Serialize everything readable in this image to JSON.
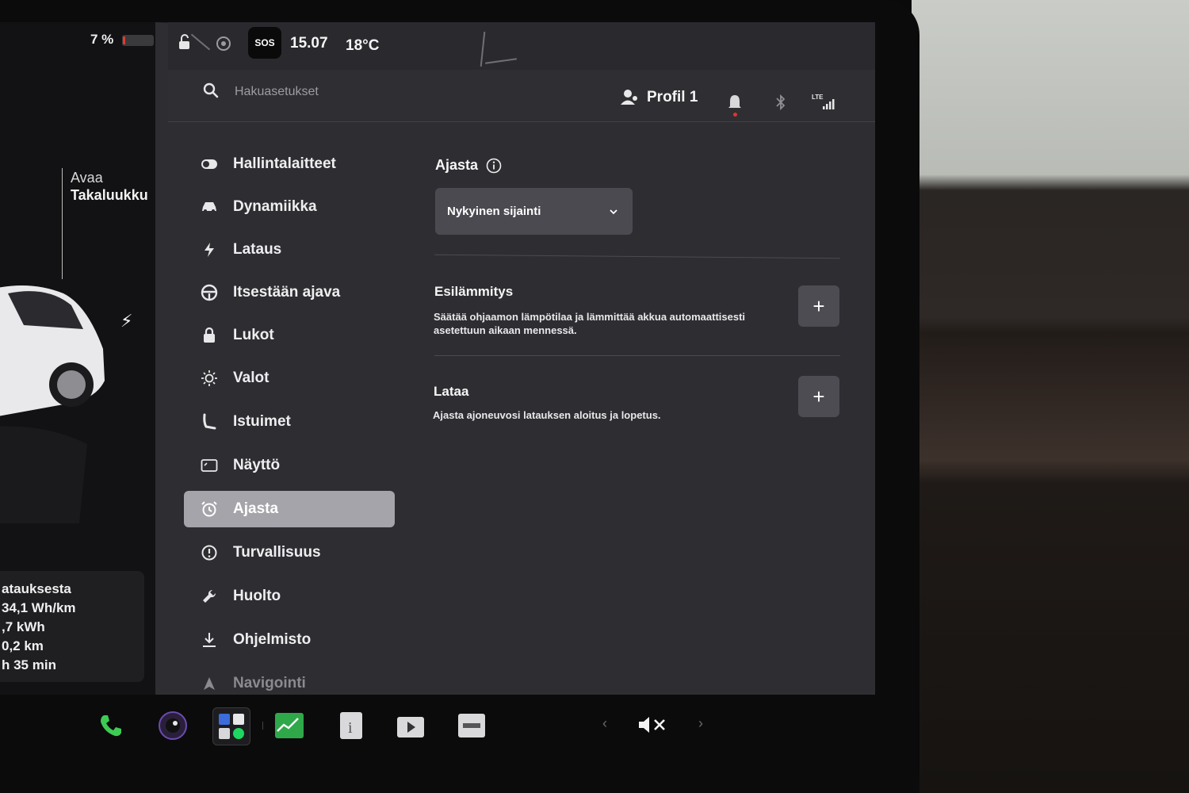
{
  "status": {
    "battery_percent": "7 %",
    "battery_level": 0.07,
    "time": "15.07",
    "temperature": "18°C",
    "sos_label": "SOS"
  },
  "car": {
    "trunk_action": "Avaa",
    "trunk_target": "Takaluukku"
  },
  "trip": {
    "rows": [
      "atauksesta",
      "34,1 Wh/km",
      ",7 kWh",
      "0,2 km",
      "h 35 min"
    ]
  },
  "search": {
    "placeholder": "Hakuasetukset"
  },
  "header": {
    "profile_label": "Profil 1",
    "lte_label": "LTE"
  },
  "sidebar": {
    "items": [
      {
        "label": "Hallintalaitteet",
        "icon": "toggle-icon"
      },
      {
        "label": "Dynamiikka",
        "icon": "car-icon"
      },
      {
        "label": "Lataus",
        "icon": "bolt-icon"
      },
      {
        "label": "Itsestään ajava",
        "icon": "steering-wheel-icon"
      },
      {
        "label": "Lukot",
        "icon": "lock-icon"
      },
      {
        "label": "Valot",
        "icon": "sun-icon"
      },
      {
        "label": "Istuimet",
        "icon": "seat-icon"
      },
      {
        "label": "Näyttö",
        "icon": "display-icon"
      },
      {
        "label": "Ajasta",
        "icon": "alarm-clock-icon",
        "active": true
      },
      {
        "label": "Turvallisuus",
        "icon": "alert-circle-icon"
      },
      {
        "label": "Huolto",
        "icon": "wrench-icon"
      },
      {
        "label": "Ohjelmisto",
        "icon": "download-icon"
      },
      {
        "label": "Navigointi",
        "icon": "navigation-icon"
      }
    ]
  },
  "schedule": {
    "title": "Ajasta",
    "location_value": "Nykyinen sijainti",
    "preheat": {
      "title": "Esilämmitys",
      "description": "Säätää ohjaamon lämpötilaa ja lämmittää akkua automaattisesti asetettuun aikaan mennessä."
    },
    "charge": {
      "title": "Lataa",
      "description": "Ajasta ajoneuvosi latauksen aloitus ja lopetus."
    },
    "add_symbol": "+"
  },
  "colors": {
    "accent_active": "#a4a4aa",
    "phone_green": "#3ecb54",
    "alert_red": "#e0352d"
  }
}
